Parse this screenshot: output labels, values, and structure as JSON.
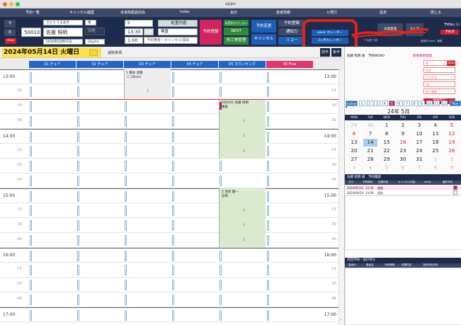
{
  "window": {
    "title": "appo"
  },
  "menu": [
    "予約一覧",
    "キャンセル履歴",
    "未来院超過前会",
    "Index",
    "会計",
    "患者情報",
    "ic発行",
    "設定",
    "閉じる"
  ],
  "toolbar": {
    "patient_id": "500101",
    "kana": "さとう てるあき",
    "sex": "男",
    "name": "佐藤 照明",
    "birth_label": "旧姓",
    "birthdate": "2010年03月01日",
    "age": "14y2m",
    "clear_label": "clear",
    "slot_count": "5",
    "time": "13:30",
    "treatment": "検査",
    "duration": "1:00",
    "memo_placeholder": "予約備考・キャンセル理由",
    "shinryo_label": "処置内容",
    "reserve_label": "予約登録",
    "unreg_label": "未受診からしない",
    "next_label": "NEXT",
    "tech_label": "技工物管理",
    "change_label": "予約変更",
    "cancel_label": "キャンセル",
    "reserve_confirm": "予約登録",
    "notify_label": "通知力",
    "recall_label": "リコー",
    "week_cal": "week カレンダー",
    "month_cal": "3ヶ月カレンダー",
    "unconfirmed_label": "未取管理",
    "karte_label": "カルテ",
    "reserve_no_label": "予約No.12",
    "reserve_list_label": "予約済",
    "user_label": "使用中(User）管理",
    "check1": "転院",
    "check2": "予約"
  },
  "date_header": {
    "date": "2024年05月14日 火曜日",
    "extra": "退院事項",
    "prev": "前半",
    "next": "後半"
  },
  "columns": [
    "01 チェア",
    "02 チェア",
    "03 チェア",
    "04 チェア",
    "05 カウンセング",
    "06 Free"
  ],
  "times": [
    {
      "label": "13:00",
      "hour": true
    },
    {
      "label": "15",
      "hour": false
    },
    {
      "label": "30",
      "hour": false
    },
    {
      "label": "45",
      "hour": false
    },
    {
      "label": "14:00",
      "hour": true
    },
    {
      "label": "15",
      "hour": false
    },
    {
      "label": "30",
      "hour": false
    },
    {
      "label": "45",
      "hour": false
    },
    {
      "label": "15:00",
      "hour": true
    },
    {
      "label": "15",
      "hour": false
    },
    {
      "label": "30",
      "hour": false
    },
    {
      "label": "45",
      "hour": false
    },
    {
      "label": "16:00",
      "hour": true
    },
    {
      "label": "15",
      "hour": false
    },
    {
      "label": "30",
      "hour": false
    },
    {
      "label": "45",
      "hour": false
    },
    {
      "label": "17:00",
      "hour": true
    }
  ],
  "appointments": {
    "a1_name": "1 橋本 想豊",
    "a1_treat": "リコ丹sim",
    "a2_name": "500101 佐藤 照明",
    "a2_treat": "検査",
    "a3_name": "2 浅見 健一",
    "a3_treat": "診断"
  },
  "right_panel": {
    "patient_line": "佐藤 照明 様　予約MEMO",
    "new_register": "新規患者登録",
    "fields": [
      "ID",
      "氏名",
      "ふりがな",
      "Tel",
      "紹介履歴"
    ],
    "register_btn": "登録完了",
    "calendar_title": "24年 5月",
    "month_tabs": [
      "today",
      "1",
      "2",
      "3",
      "4",
      "5",
      "6",
      "7",
      "8",
      "9",
      "10",
      "11",
      "12",
      "Year"
    ],
    "weekdays": [
      "MON",
      "TUE",
      "WED",
      "THU",
      "FRI",
      "SAT",
      "SUN"
    ],
    "weeks": [
      [
        "29",
        "30",
        "1",
        "2",
        "3",
        "4",
        "5"
      ],
      [
        "6",
        "7",
        "8",
        "9",
        "10",
        "11",
        "12"
      ],
      [
        "13",
        "14",
        "15",
        "16",
        "17",
        "18",
        "19"
      ],
      [
        "20",
        "21",
        "22",
        "23",
        "24",
        "25",
        "26"
      ],
      [
        "27",
        "28",
        "29",
        "30",
        "31",
        "1",
        "2"
      ],
      [
        "3",
        "4",
        "5",
        "6",
        "7",
        "8",
        "9"
      ]
    ],
    "history_title": "佐藤 照明 様　予約履歴",
    "history_headers": [
      "日付",
      "予約時刻",
      "処置内容",
      "キャンセル内容",
      "recall",
      "最終予約"
    ],
    "history_rows": [
      [
        "2024/05/14",
        "13:30",
        "検査"
      ],
      [
        "2024/04/24",
        "14:00",
        "初診"
      ]
    ],
    "next_title": "次回予約・会計待ち",
    "next_headers": [
      "患者ID",
      "患者名",
      "予約時間",
      "処置内容",
      "次回予約日時"
    ]
  }
}
